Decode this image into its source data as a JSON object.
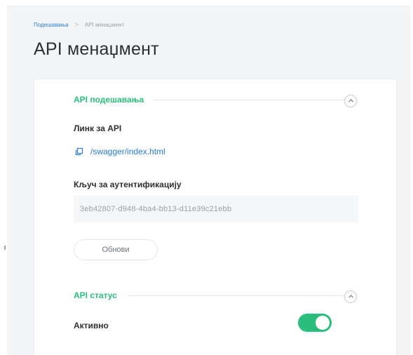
{
  "breadcrumb": {
    "parent": "Подешавања",
    "separator": ">",
    "current": "API менаџмент"
  },
  "page": {
    "title": "API менаџмент"
  },
  "api_settings": {
    "section_title": "API подешавања",
    "link_label": "Линк за API",
    "link_text": "/swagger/index.html",
    "key_label": "Кључ за аутентификацију",
    "key_value": "3eb42807-d948-4ba4-bb13-d11e39c21ebb",
    "refresh_label": "Обнови",
    "collapse_icon": "chevron-up-icon"
  },
  "api_status": {
    "section_title": "API статус",
    "active_label": "Активно",
    "active": true,
    "collapse_icon": "chevron-up-icon"
  },
  "colors": {
    "accent_green": "#2bbd7e",
    "link_blue": "#2a7bd3",
    "background": "#f4f5f7"
  }
}
